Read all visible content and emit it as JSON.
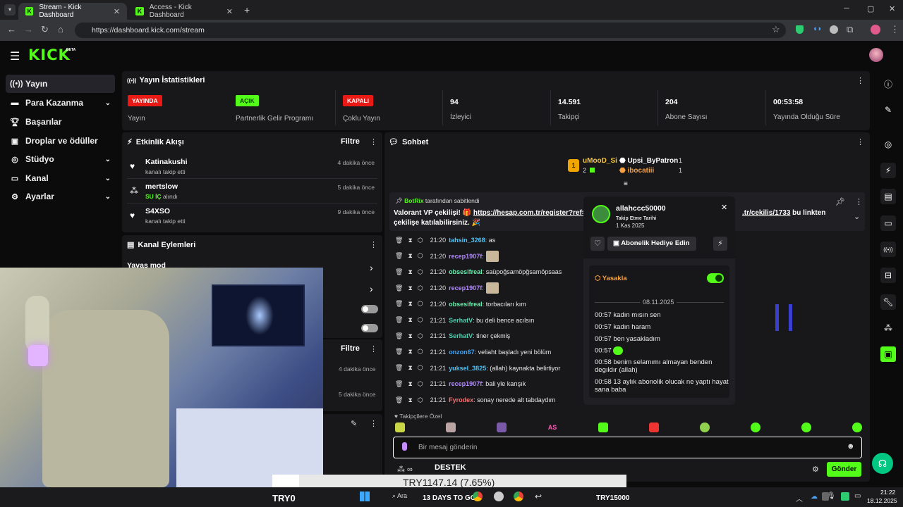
{
  "browser": {
    "tabs": [
      {
        "title": "Stream - Kick Dashboard"
      },
      {
        "title": "Access - Kick Dashboard"
      }
    ],
    "url": "https://dashboard.kick.com/stream"
  },
  "brand": {
    "logo": "KICK",
    "beta": "BETA",
    "accent": "#53fc18"
  },
  "sidebar": {
    "items": [
      {
        "label": "Yayın",
        "icon": "broadcast-icon"
      },
      {
        "label": "Para Kazanma",
        "icon": "money-icon"
      },
      {
        "label": "Başarılar",
        "icon": "trophy-icon"
      },
      {
        "label": "Droplar ve ödüller",
        "icon": "gift-icon"
      },
      {
        "label": "Stüdyo",
        "icon": "studio-icon"
      },
      {
        "label": "Kanal",
        "icon": "channel-icon"
      },
      {
        "label": "Ayarlar",
        "icon": "gear-icon"
      }
    ]
  },
  "stats": {
    "title": "Yayın İstatistikleri",
    "items": [
      {
        "value": "YAYINDA",
        "label": "Yayın",
        "color": "#e91916"
      },
      {
        "value": "AÇIK",
        "label": "Partnerlik Gelir Programı",
        "color": "#53fc18"
      },
      {
        "value": "KAPALI",
        "label": "Çoklu Yayın",
        "color": "#e91916"
      },
      {
        "value": "94",
        "label": "İzleyici"
      },
      {
        "value": "14.591",
        "label": "Takipçi"
      },
      {
        "value": "204",
        "label": "Abone Sayısı"
      },
      {
        "value": "00:53:58",
        "label": "Yayında Olduğu Süre"
      }
    ]
  },
  "activity": {
    "title": "Etkinlik Akışı",
    "filter": "Filtre",
    "items": [
      {
        "name": "Katinakushi",
        "sub": "kanalı takip etti",
        "time": "4 dakika önce"
      },
      {
        "name": "mertslow",
        "sub_green": "SU İÇ",
        "sub": "alındı",
        "time": "5 dakika önce"
      },
      {
        "name": "S4XSO",
        "sub": "kanalı takip etti",
        "time": "9 dakika önce"
      }
    ]
  },
  "channel_actions": {
    "title": "Kanal Eylemleri",
    "slow_mode": "Yavaş mod"
  },
  "second_feed": {
    "filter": "Filtre",
    "times": [
      "4 dakika önce",
      "5 dakika önce"
    ]
  },
  "chat": {
    "title": "Sohbet",
    "leaders": [
      {
        "name": "uMooD_Si",
        "count": "2"
      },
      {
        "name": "Upsi_ByPatron",
        "count": "1"
      },
      {
        "name": "ibocatiii",
        "count": "1"
      }
    ],
    "pinned": {
      "by": "BotRix",
      "by_suffix": "tarafından sabitlendi",
      "text1": "Valorant VP çekilişi! 🎁",
      "link": "https://hesap.com.tr/register?ref=",
      "link2": ".tr/cekilis/1733",
      "text2": "bu linkten",
      "text3": "çekilişe katılabilirsiniz. 🎉"
    },
    "messages": [
      {
        "time": "21:20",
        "user": "tahsin_3268",
        "color": "#4fc3f7",
        "text": ": as"
      },
      {
        "time": "21:20",
        "user": "recep1907f",
        "color": "#b388ff",
        "text": ":"
      },
      {
        "time": "21:20",
        "user": "obsesifreal",
        "color": "#69f0ae",
        "text": ": saüpoğsamöpğsamöpsaas"
      },
      {
        "time": "21:20",
        "user": "recep1907f",
        "color": "#b388ff",
        "text": ":"
      },
      {
        "time": "21:20",
        "user": "obsesifreal",
        "color": "#69f0ae",
        "text": ": torbacıları kım"
      },
      {
        "time": "21:21",
        "user": "SerhatV",
        "color": "#4dd0b0",
        "text": ": bu deli bence acılsın"
      },
      {
        "time": "21:21",
        "user": "SerhatV",
        "color": "#4dd0b0",
        "text": ": tiner çekmiş"
      },
      {
        "time": "21:21",
        "user": "onzon67",
        "color": "#42a5f5",
        "text": ": veliaht başladı yeni bölüm"
      },
      {
        "time": "21:21",
        "user": "yuksel_3825",
        "color": "#4fc3f7",
        "text": ": (allah) kaynakta belirtiyor"
      },
      {
        "time": "21:21",
        "user": "recep1907f",
        "color": "#b388ff",
        "text": ": bali yle karışık"
      },
      {
        "time": "21:21",
        "user": "Fyrodex",
        "color": "#ff6e6e",
        "text": ": sonay nerede alt tabdaydım"
      }
    ],
    "followers_only": "Takipçilere Özel",
    "input_placeholder": "Bir mesaj gönderin",
    "send": "Gönder",
    "destek": "DESTEK"
  },
  "popup": {
    "user": "allahccc50000",
    "follow_label": "Takip Etme Tarihi",
    "follow_date": "1 Kas 2025",
    "gift_button": "Abonelik Hediye Edin",
    "ban_label": "Yasakla",
    "date": "08.11.2025",
    "messages": [
      {
        "time": "00:57",
        "text": "kadın mısın sen"
      },
      {
        "time": "00:57",
        "text": "kadın haram"
      },
      {
        "time": "00:57",
        "text": "ben yasakladım"
      },
      {
        "time": "00:57",
        "text": ""
      },
      {
        "time": "00:58",
        "text": "benim selamımı almayan benden degıldır (allah)"
      },
      {
        "time": "00:58",
        "text": "13 aylık abonolik olucak ne yaptı hayat sana baba"
      }
    ]
  },
  "overlay": {
    "ticker": "TRY1147.14 (7.65%)",
    "left": "TRY0",
    "mid": "13 DAYS TO GO",
    "right": "TRY15000"
  },
  "taskbar": {
    "search": "Ara",
    "time": "21:22",
    "date": "18.12.2025"
  }
}
